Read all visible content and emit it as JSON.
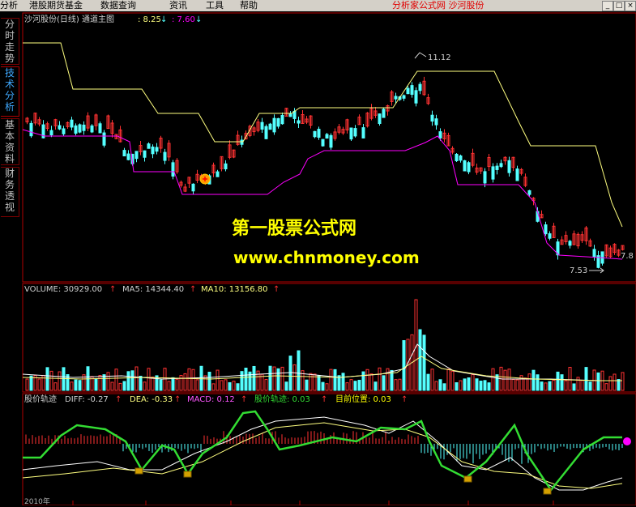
{
  "menu": {
    "items": [
      "分析",
      "港股期货基金",
      "数据查询",
      "资讯",
      "工具",
      "帮助"
    ],
    "brand": "分析家公式网  沙河股份",
    "window_buttons": [
      "_",
      "□",
      "×"
    ]
  },
  "side_tabs": [
    {
      "label": "分时走势",
      "active": false
    },
    {
      "label": "技术分析",
      "active": true
    },
    {
      "label": "基本资料",
      "active": false
    },
    {
      "label": "财务透视",
      "active": false
    }
  ],
  "main_panel": {
    "title": "沙河股份(日线) 通道主图",
    "value1": ": 8.25",
    "value2": ": 7.60",
    "arrow": "↓",
    "high_label": "11.12",
    "low_label": "7.53",
    "right_label": "7.8"
  },
  "volume_panel": {
    "volume_label": "VOLUME: 30929.00",
    "ma5_label": "MA5: 14344.40",
    "ma10_label": "MA10: 13156.80",
    "arrow": "↑"
  },
  "macd_panel": {
    "name_label": "股价轨迹",
    "diff_label": "DIFF: -0.27",
    "dea_label": "DEA: -0.33",
    "macd_label": "MACD: 0.12",
    "track_label": "股价轨迹: 0.03",
    "position_label": "目前位置: 0.03",
    "arrow": "↑"
  },
  "watermark": {
    "line1": "第一股票公式网",
    "line2": "www.chnmoney.com"
  },
  "bottom_axis": {
    "year_label": "2010年"
  },
  "colors": {
    "up": "#ff3232",
    "down": "#54ffff",
    "upper_band": "#ffff80",
    "lower_band": "#ff00ff",
    "track_line": "#33dd33",
    "border": "#b00000",
    "watermark": "#ffff00",
    "macd_label": "#ff55ff"
  },
  "icons": [
    "buy-signal-icon",
    "position-dot-icon",
    "marker-icon"
  ]
}
